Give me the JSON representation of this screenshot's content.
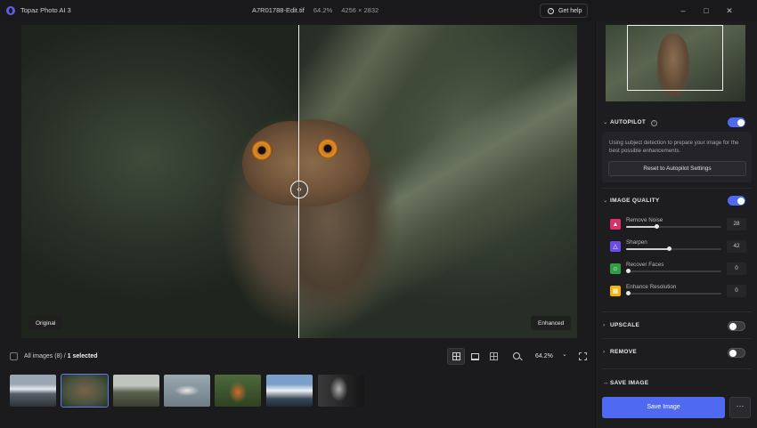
{
  "app": {
    "title": "Topaz Photo AI 3"
  },
  "file": {
    "name": "A7R01788-Edit.tif",
    "zoom": "64.2%",
    "dimensions": "4256 × 2832"
  },
  "header": {
    "help_label": "Get help",
    "window_controls": {
      "minimize": "–",
      "maximize": "□",
      "close": "✕"
    }
  },
  "viewer": {
    "left_label": "Original",
    "right_label": "Enhanced",
    "split_handle_glyph": "‹›"
  },
  "toolbar": {
    "all_images_label": "All images (8)",
    "separator": "/",
    "selected_label": "1 selected",
    "zoom_value": "64.2%",
    "zoom_caret": "⌄"
  },
  "thumbnails": [
    {
      "subject": "mountain-landscape",
      "selected": false
    },
    {
      "subject": "owl",
      "selected": true
    },
    {
      "subject": "moose-in-field",
      "selected": false
    },
    {
      "subject": "bird-in-flight",
      "selected": false
    },
    {
      "subject": "fox",
      "selected": false
    },
    {
      "subject": "snowy-mountain",
      "selected": false
    },
    {
      "subject": "portrait-bw",
      "selected": false
    }
  ],
  "panel": {
    "autopilot": {
      "title": "AUTOPILOT",
      "enabled": true,
      "description": "Using subject detection to prepare your image for the best possible enhancements.",
      "reset_label": "Reset to Autopilot Settings"
    },
    "image_quality": {
      "title": "IMAGE QUALITY",
      "enabled": true,
      "settings": [
        {
          "label": "Remove Noise",
          "value": "28",
          "level": 0.32,
          "color": "#d6336c",
          "icon": "▲"
        },
        {
          "label": "Sharpen",
          "value": "42",
          "level": 0.45,
          "color": "#6b4de6",
          "icon": "△"
        },
        {
          "label": "Recover Faces",
          "value": "0",
          "level": 0.0,
          "color": "#2f9e44",
          "icon": "☺"
        },
        {
          "label": "Enhance Resolution",
          "value": "0",
          "level": 0.0,
          "color": "#f2b705",
          "icon": "▦"
        }
      ]
    },
    "upscale": {
      "title": "UPSCALE",
      "enabled": false
    },
    "remove": {
      "title": "REMOVE",
      "enabled": false
    },
    "save_image": {
      "title": "SAVE IMAGE",
      "button_label": "Save Image",
      "more_label": "···"
    }
  },
  "colors": {
    "accent": "#4f6af0",
    "background": "#1b1b1d",
    "panel": "#1d1d20"
  }
}
